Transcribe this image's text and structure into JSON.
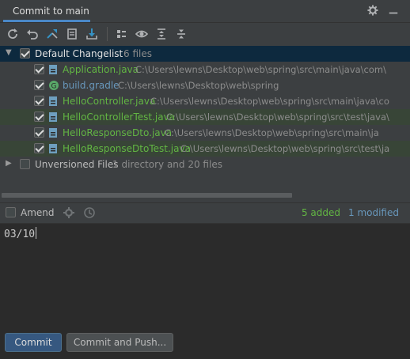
{
  "window": {
    "tab_title": "Commit to main"
  },
  "toolbar": {
    "buttons": [
      "refresh-icon",
      "rollback-icon",
      "show-diff-icon",
      "shelve-icon",
      "update-icon",
      "group-by-icon",
      "view-options-icon",
      "expand-all-icon",
      "collapse-all-icon"
    ]
  },
  "changelist": {
    "name": "Default Changelist",
    "count": "6 files",
    "files": [
      {
        "name": "Application.java",
        "path": "C:\\Users\\lewns\\Desktop\\web\\spring\\src\\main\\java\\com\\",
        "color": "green",
        "icon": "java-class-icon",
        "highlight": false
      },
      {
        "name": "build.gradle",
        "path": "C:\\Users\\lewns\\Desktop\\web\\spring",
        "color": "blue",
        "icon": "gradle-icon",
        "highlight": false
      },
      {
        "name": "HelloController.java",
        "path": "C:\\Users\\lewns\\Desktop\\web\\spring\\src\\main\\java\\co",
        "color": "green",
        "icon": "java-class-icon",
        "highlight": false
      },
      {
        "name": "HelloControllerTest.java",
        "path": "C:\\Users\\lewns\\Desktop\\web\\spring\\src\\test\\java\\",
        "color": "green",
        "icon": "java-class-icon",
        "highlight": true
      },
      {
        "name": "HelloResponseDto.java",
        "path": "C:\\Users\\lewns\\Desktop\\web\\spring\\src\\main\\ja",
        "color": "green",
        "icon": "java-class-icon",
        "highlight": false
      },
      {
        "name": "HelloResponseDtoTest.java",
        "path": "C:\\Users\\lewns\\Desktop\\web\\spring\\src\\test\\ja",
        "color": "green",
        "icon": "java-class-icon",
        "highlight": true
      }
    ]
  },
  "unversioned": {
    "label": "Unversioned Files",
    "info": "1 directory and 20 files"
  },
  "amend": {
    "label": "Amend",
    "added": "5 added",
    "modified": "1 modified"
  },
  "message": {
    "text": "03/10"
  },
  "buttons": {
    "commit": "Commit",
    "commit_push": "Commit and Push..."
  },
  "colors": {
    "accent": "#4a88c7",
    "added": "#62b543",
    "modified": "#6897bb",
    "selection": "#0d293e",
    "highlight": "#384537"
  }
}
